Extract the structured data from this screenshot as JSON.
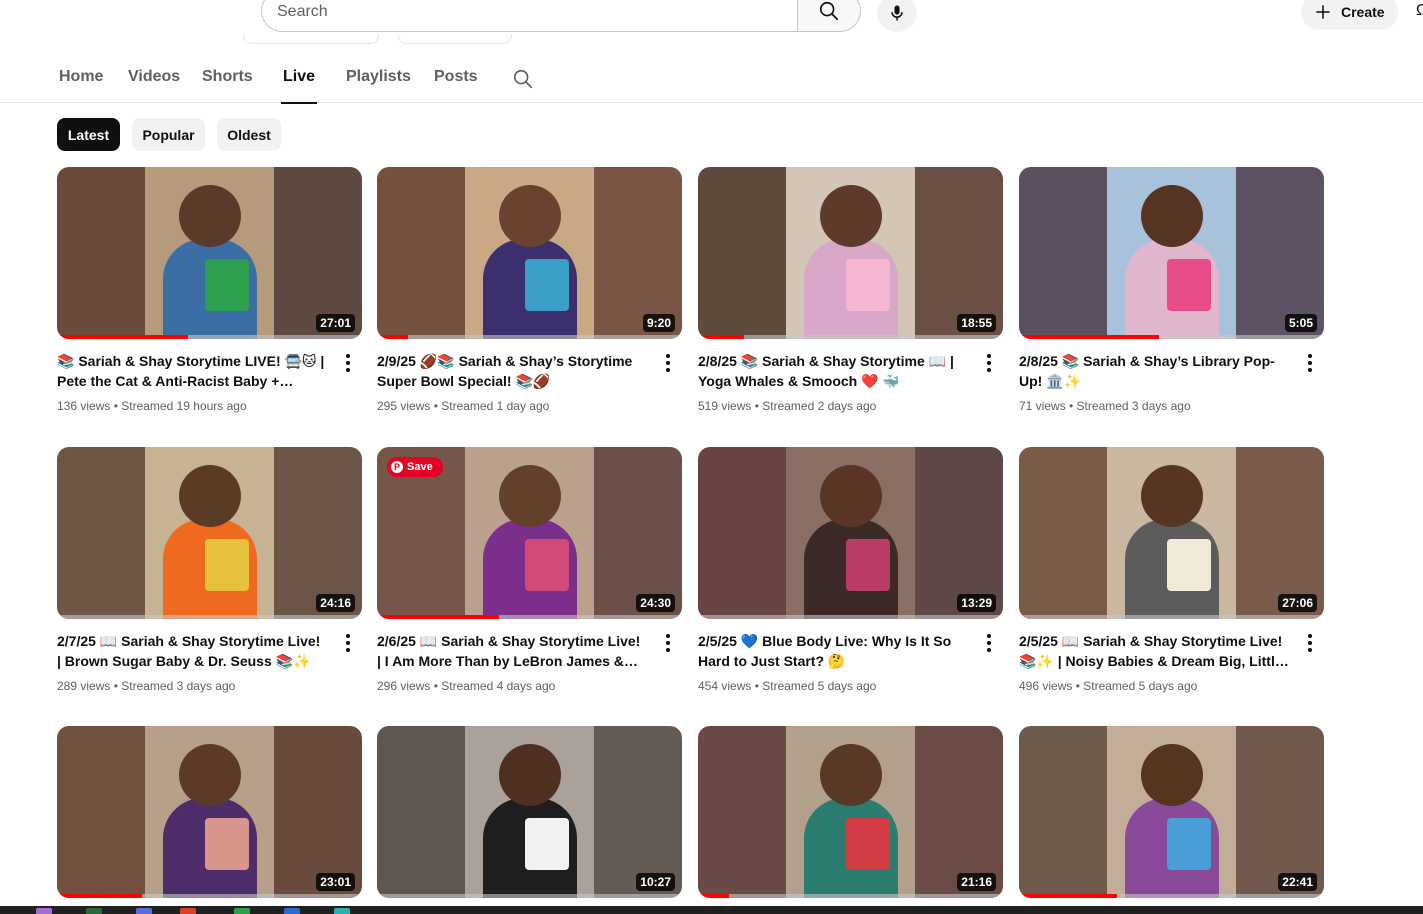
{
  "masthead": {
    "search_placeholder": "Search",
    "search_icon": "search-icon",
    "mic_icon": "microphone-icon",
    "create_label": "Create",
    "create_icon": "plus-icon",
    "edge_glyph": "Ω"
  },
  "tabs": [
    {
      "label": "Home",
      "active": false
    },
    {
      "label": "Videos",
      "active": false
    },
    {
      "label": "Shorts",
      "active": false
    },
    {
      "label": "Live",
      "active": true
    },
    {
      "label": "Playlists",
      "active": false
    },
    {
      "label": "Posts",
      "active": false
    }
  ],
  "filters": [
    {
      "label": "Latest",
      "active": true
    },
    {
      "label": "Popular",
      "active": false
    },
    {
      "label": "Oldest",
      "active": false
    }
  ],
  "videos": [
    {
      "title": "📚 Sariah & Shay Storytime LIVE! 🚍🐱 | Pete the Cat & Anti-Racist Baby + Spanish...",
      "stats": "136 views • Streamed 19 hours ago",
      "duration": "27:01",
      "progress": 0.43,
      "palette": {
        "left": "#6b4a3c",
        "right": "#5e4a40",
        "bg": "#b59a7c",
        "skin": "#5a3a28",
        "shirt": "#3a6ea5",
        "prop": "#2e9e4f"
      }
    },
    {
      "title": "2/9/25 🏈📚 Sariah & Shay’s Storytime Super Bowl Special! 📚🏈",
      "stats": "295 views • Streamed 1 day ago",
      "duration": "9:20",
      "progress": 0.1,
      "palette": {
        "left": "#74503f",
        "right": "#7a5545",
        "bg": "#c9a985",
        "skin": "#6a4330",
        "shirt": "#3b2f6e",
        "prop": "#3aa0c8"
      }
    },
    {
      "title": "2/8/25 📚 Sariah & Shay Storytime 📖 | Yoga Whales & Smooch ❤️ 🐳",
      "stats": "519 views • Streamed 2 days ago",
      "duration": "18:55",
      "progress": 0.15,
      "palette": {
        "left": "#5f4a3e",
        "right": "#6a5044",
        "bg": "#d3c6b6",
        "skin": "#5d3a29",
        "shirt": "#d9a7c7",
        "prop": "#f4b6d2"
      }
    },
    {
      "title": "2/8/25 📚 Sariah & Shay’s Library Pop-Up! 🏛️✨",
      "stats": "71 views • Streamed 3 days ago",
      "duration": "5:05",
      "progress": 0.46,
      "palette": {
        "left": "#5a5060",
        "right": "#5d5263",
        "bg": "#a9c2dc",
        "skin": "#553424",
        "shirt": "#e2b6cf",
        "prop": "#e84b8a"
      }
    },
    {
      "title": "2/7/25 📖 Sariah & Shay Storytime Live! | Brown Sugar Baby & Dr. Seuss 📚✨",
      "stats": "289 views • Streamed 3 days ago",
      "duration": "24:16",
      "progress": 0.0,
      "palette": {
        "left": "#6e5646",
        "right": "#6a5547",
        "bg": "#c8b294",
        "skin": "#5b3a26",
        "shirt": "#ef6a1e",
        "prop": "#e6c13c"
      }
    },
    {
      "title": "2/6/25 📖 Sariah & Shay Storytime Live! | I Am More Than by LeBron James & Spanish...",
      "stats": "296 views • Streamed 4 days ago",
      "duration": "24:30",
      "progress": 0.4,
      "palette": {
        "left": "#76564a",
        "right": "#6b4f48",
        "bg": "#b9a18d",
        "skin": "#62402c",
        "shirt": "#7b2e8a",
        "prop": "#d24a7a"
      }
    },
    {
      "title": "2/5/25 💙 Blue Body Live: Why Is It So Hard to Just Start? 🤔",
      "stats": "454 views • Streamed 5 days ago",
      "duration": "13:29",
      "progress": 0.0,
      "palette": {
        "left": "#6a4444",
        "right": "#5e4848",
        "bg": "#8a6f64",
        "skin": "#5a3525",
        "shirt": "#3b2a26",
        "prop": "#b83c66"
      }
    },
    {
      "title": "2/5/25 📖 Sariah & Shay Storytime Live! 📚✨ | Noisy Babies & Dream Big, Little One ...",
      "stats": "496 views • Streamed 5 days ago",
      "duration": "27:06",
      "progress": 0.0,
      "palette": {
        "left": "#7a5a48",
        "right": "#7a5a4b",
        "bg": "#c9b7a2",
        "skin": "#563623",
        "shirt": "#5c5c5c",
        "prop": "#f1e9d8"
      }
    },
    {
      "title": "",
      "stats": "",
      "duration": "23:01",
      "progress": 0.28,
      "palette": {
        "left": "#72503f",
        "right": "#6b4a3e",
        "bg": "#b7a08a",
        "skin": "#5c3a27",
        "shirt": "#4d2c6a",
        "prop": "#d9958c"
      }
    },
    {
      "title": "",
      "stats": "",
      "duration": "10:27",
      "progress": 0.0,
      "palette": {
        "left": "#5e5650",
        "right": "#655b55",
        "bg": "#a9a19a",
        "skin": "#4e3023",
        "shirt": "#1e1e1e",
        "prop": "#f2f2f2"
      }
    },
    {
      "title": "",
      "stats": "",
      "duration": "21:16",
      "progress": 0.1,
      "palette": {
        "left": "#6a4a46",
        "right": "#6b4b45",
        "bg": "#b3a08c",
        "skin": "#5a3826",
        "shirt": "#2b7d6f",
        "prop": "#d23c45"
      }
    },
    {
      "title": "",
      "stats": "",
      "duration": "22:41",
      "progress": 0.32,
      "palette": {
        "left": "#6e5a4a",
        "right": "#71584c",
        "bg": "#c2ae98",
        "skin": "#55351f",
        "shirt": "#8a4a9a",
        "prop": "#4a9ed8"
      }
    }
  ],
  "pin_save_label": "Save"
}
